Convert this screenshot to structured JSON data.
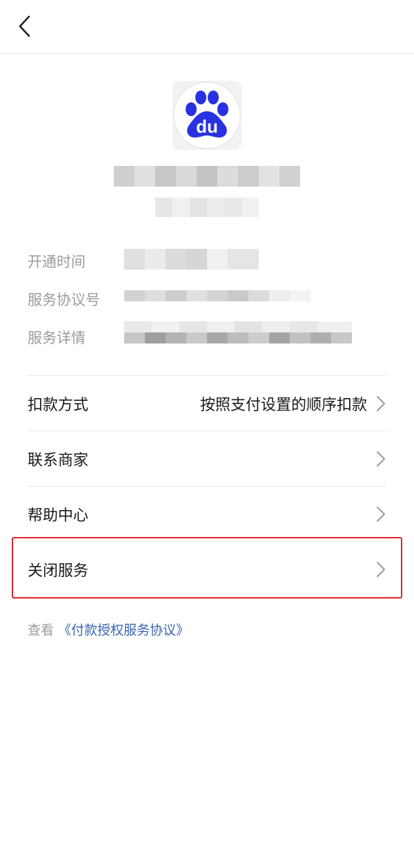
{
  "header": {
    "back_icon": "chevron-left-icon"
  },
  "merchant": {
    "logo_icon": "baidu-paw-logo-icon",
    "logo_text": "du",
    "logo_color": "#2932e1",
    "name": "",
    "subtitle": ""
  },
  "info": {
    "open_time_label": "开通时间",
    "agreement_no_label": "服务协议号",
    "service_detail_label": "服务详情"
  },
  "menu": {
    "deduction_label": "扣款方式",
    "deduction_value": "按照支付设置的顺序扣款",
    "contact_label": "联系商家",
    "help_label": "帮助中心",
    "close_label": "关闭服务"
  },
  "footer": {
    "view_prefix": "查看",
    "agreement_link": "《付款授权服务协议》"
  },
  "colors": {
    "accent_link": "#3b66b1",
    "highlight_border": "#e5202a"
  }
}
